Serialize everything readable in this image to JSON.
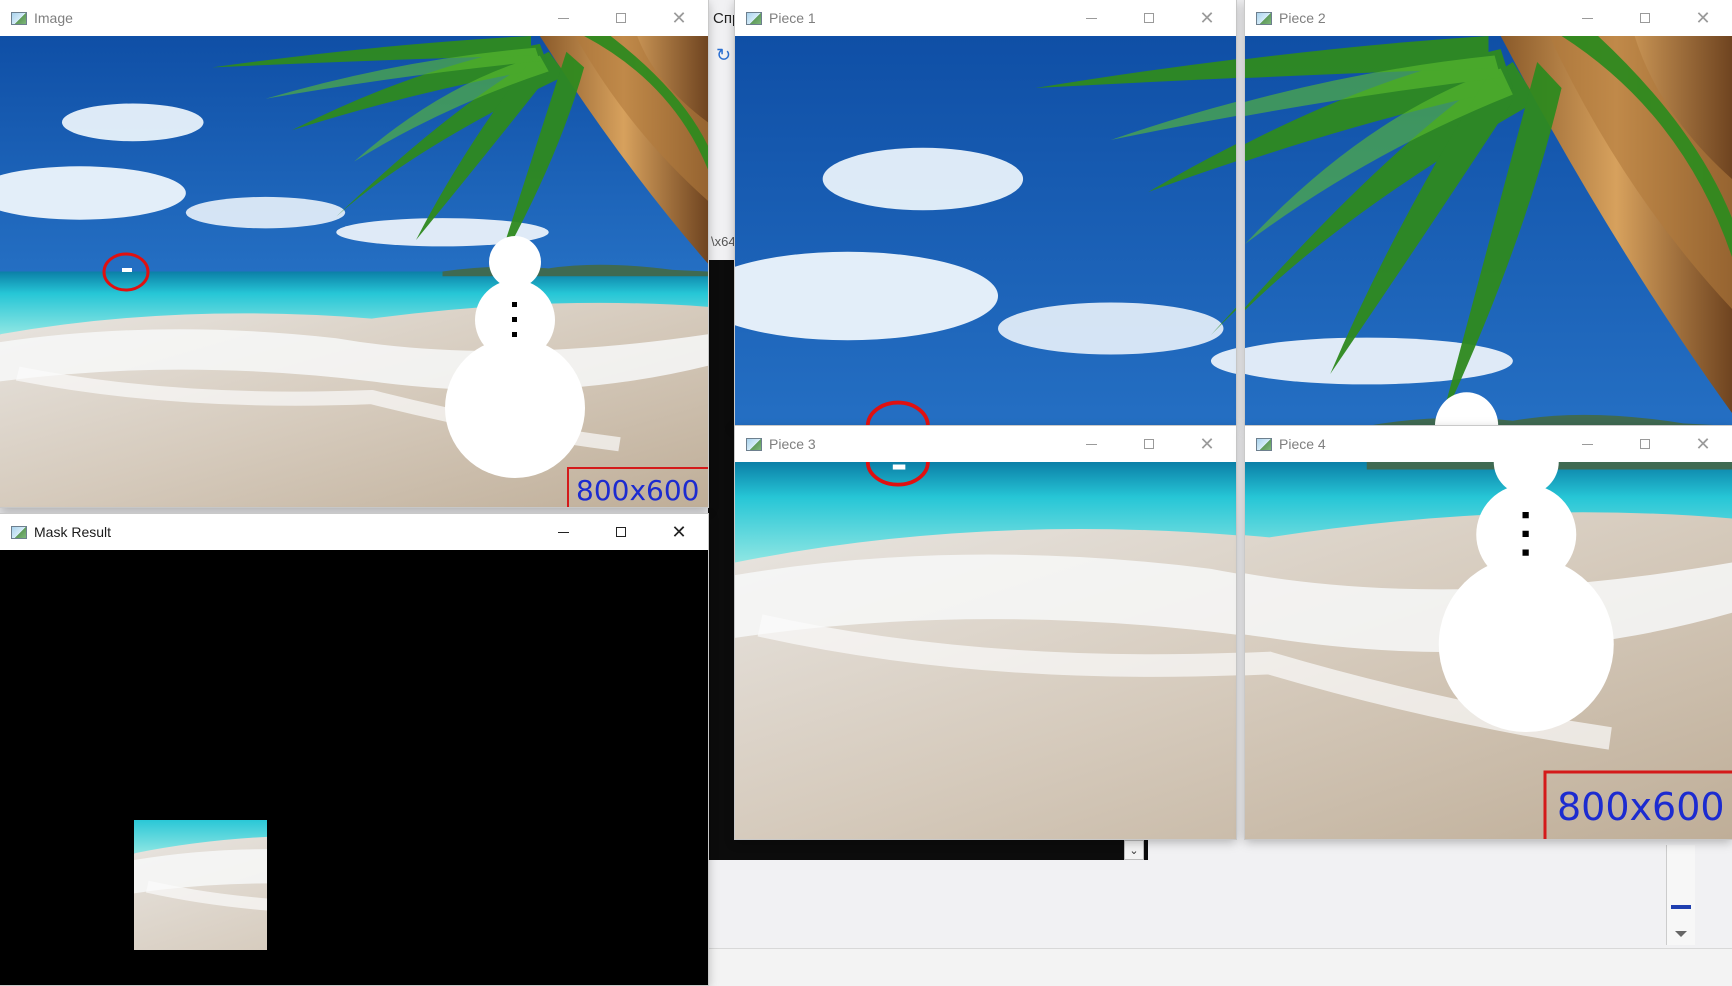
{
  "windows": {
    "image": {
      "title": "Image",
      "size_label": "800x600"
    },
    "mask": {
      "title": "Mask Result"
    },
    "piece1": {
      "title": "Piece 1"
    },
    "piece2": {
      "title": "Piece 2"
    },
    "piece3": {
      "title": "Piece 3"
    },
    "piece4": {
      "title": "Piece 4",
      "size_label": "800x600"
    }
  },
  "background_app": {
    "partial_text_1": "Спр",
    "partial_text_2": "\\x64"
  },
  "icons": [
    "window-app-icon",
    "minimize-icon",
    "maximize-icon",
    "close-icon",
    "chevron-down-icon",
    "refresh-icon"
  ],
  "colors": {
    "label_blue": "#1c2bd0",
    "label_border_red": "#d41a1a",
    "circle_red": "#e01010",
    "sky": "#1f6fc2",
    "sea": "#2ec5cf",
    "sand": "#cfc2ae"
  }
}
